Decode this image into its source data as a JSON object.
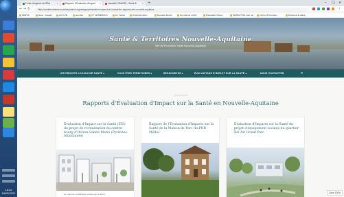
{
  "browser": {
    "tabs": [
      {
        "label": "Fonds d'urgence de l'État"
      },
      {
        "label": "Rapports d'Évaluation d'Impact"
      },
      {
        "label": "Lavanitié CRAVISE - Santé &"
      }
    ],
    "url": "https://santeterritoiresnouvelleaquitaine.org/category/evaluation-impact-sur-la-sante/les-rapports-deis-nouvelle-aquitaine",
    "bookmarks": [
      {
        "label": "PERTIA"
      },
      {
        "label": "Nexo - Google"
      },
      {
        "label": "ACTI-VÉ"
      },
      {
        "label": "seronda"
      },
      {
        "label": "ITT HOSMÉDICA"
      },
      {
        "label": "Arr. Social"
      },
      {
        "label": "Université dans..."
      },
      {
        "label": "Nouveau bouton"
      },
      {
        "label": "Nos dernier article"
      },
      {
        "label": "Préparation Pierre"
      },
      {
        "label": "INSPECTION pour ton"
      },
      {
        "label": "Lettre d'information"
      },
      {
        "label": "Décisions et aides"
      }
    ]
  },
  "site": {
    "title": "Santé & Territoires Nouvelle-Aquitaine",
    "subtitle": "Site de Promotion Santé Nouvelle-Aquitaine"
  },
  "menu": [
    {
      "label": "LES PROJETS LOCAUX DE SANTÉ ▾"
    },
    {
      "label": "VOUS ÊTES TERRITOIRES ▾"
    },
    {
      "label": "RESSOURCES ▾"
    },
    {
      "label": "ÉVALUATIONS D'IMPACT SUR LA SANTÉ ▾"
    },
    {
      "label": "NOUS CONTACTER"
    }
  ],
  "page": {
    "title": "Rapports d'Évaluation d'Impact sur la Santé en Nouvelle-Aquitaine"
  },
  "cards": [
    {
      "title": "Évaluation d'Impact sur la Santé (EIS) du projet de revitalisation du centre-bourg d'Oloron-Sainte-Marie (Pyrénées-Atlantiques)",
      "excerpt": "Le projet de revitalisation portée par la Mairie"
    },
    {
      "title": "Rapport de l'Évaluation d'Impacts sur la Santé de la Maison de Parc du PNR Médoc",
      "excerpt": ""
    },
    {
      "title": "Évaluation d'Impacts sur la Santé du projet d'équipement sociaux du quartier Bel Air Grand Parc",
      "excerpt": ""
    }
  ],
  "status": {
    "zoom": "Zoom 100%",
    "clock_time": "15:42",
    "clock_date": "18/05/2021"
  }
}
